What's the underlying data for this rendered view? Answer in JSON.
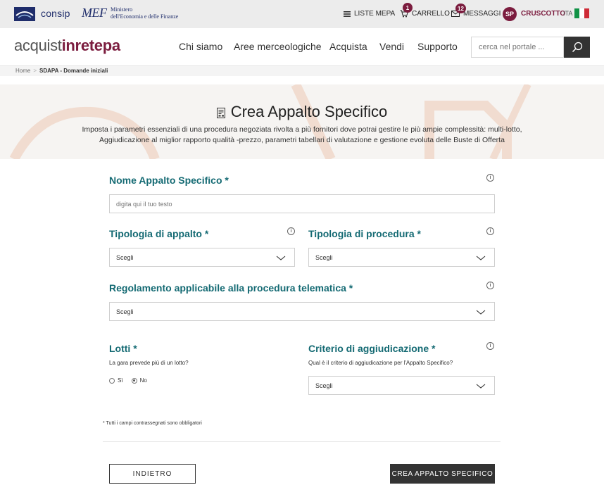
{
  "topbar": {
    "consip_label": "consip",
    "mef_label": "MEF",
    "mef_sub_line1": "Ministero",
    "mef_sub_line2": "dell'Economia e delle Finanze",
    "liste_mepa": "LISTE MEPA",
    "carrello": "CARRELLO",
    "carrello_count": "1",
    "messaggi": "MESSAGGI",
    "messaggi_count": "12",
    "avatar_initials": "SP",
    "cruscotto": "CRUSCOTTO",
    "lang": "ITA",
    "flag_colors": [
      "#119246",
      "#ffffff",
      "#ce2b37"
    ]
  },
  "navbar": {
    "brand_part1": "acquist",
    "brand_part2": "inrete",
    "brand_part3": "pa",
    "links": [
      "Chi siamo",
      "Aree merceologiche",
      "Acquista",
      "Vendi",
      "Supporto"
    ],
    "search_placeholder": "cerca nel portale ..."
  },
  "breadcrumb": {
    "home": "Home",
    "separator": ">",
    "current": "SDAPA - Domande iniziali"
  },
  "hero": {
    "title": "Crea Appalto Specifico",
    "description": "Imposta i parametri essenziali di una procedura negoziata rivolta a più fornitori dove potrai gestire le più ampie complessità: multi-lotto, Aggiudicazione al miglior rapporto qualità -prezzo, parametri tabellari di valutazione e gestione evoluta delle Buste di Offerta"
  },
  "form": {
    "nome": {
      "label": "Nome Appalto Specifico *",
      "placeholder": "digita qui il tuo testo",
      "value": ""
    },
    "tipologia_appalto": {
      "label": "Tipologia di appalto *",
      "selected": "Scegli"
    },
    "tipologia_procedura": {
      "label": "Tipologia di procedura *",
      "selected": "Scegli"
    },
    "regolamento": {
      "label": "Regolamento applicabile alla procedura telematica *",
      "selected": "Scegli"
    },
    "lotti": {
      "label": "Lotti *",
      "help": "La gara prevede più di un lotto?",
      "options": [
        "Sì",
        "No"
      ],
      "selected": "No"
    },
    "criterio": {
      "label": "Criterio di aggiudicazione *",
      "help": "Qual è il criterio di aggiudicazione per l'Appalto Specifico?",
      "selected": "Scegli"
    },
    "info_glyph": "i",
    "required_note": "* Tutti i campi contrassegnati sono obbligatori"
  },
  "actions": {
    "back_label": "INDIETRO",
    "create_label": "CREA APPALTO SPECIFICO"
  },
  "colors": {
    "brand": "#7b1c3e",
    "label": "#146a73",
    "dark_button": "#333333"
  }
}
